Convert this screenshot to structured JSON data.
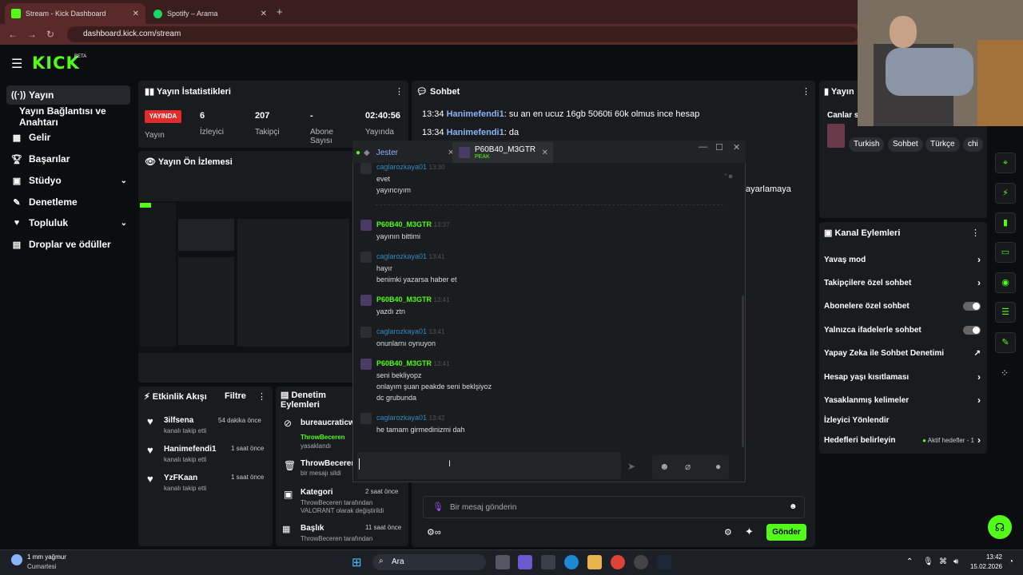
{
  "browser": {
    "tabs": [
      {
        "label": "Stream - Kick Dashboard"
      },
      {
        "label": "Spotify – Arama"
      }
    ],
    "url": "dashboard.kick.com/stream"
  },
  "kick": {
    "logo": "KICK",
    "beta": "BETA"
  },
  "nav": [
    {
      "label": "Yayın",
      "icon": "broadcast-icon"
    },
    {
      "label": "Yayın Bağlantısı ve Anahtarı",
      "icon": ""
    },
    {
      "label": "Gelir",
      "icon": "revenue-icon"
    },
    {
      "label": "Başarılar",
      "icon": "trophy-icon"
    },
    {
      "label": "Stüdyo",
      "icon": "studio-icon"
    },
    {
      "label": "Denetleme",
      "icon": "moderation-icon"
    },
    {
      "label": "Topluluk",
      "icon": "community-icon"
    },
    {
      "label": "Droplar ve ödüller",
      "icon": "drops-icon"
    }
  ],
  "stats": {
    "title": "Yayın İstatistikleri",
    "badge": "YAYINDA",
    "items": [
      {
        "value": "",
        "label": "Yayın"
      },
      {
        "value": "6",
        "label": "İzleyici"
      },
      {
        "value": "207",
        "label": "Takipçi"
      },
      {
        "value": "-",
        "label": "Abone Sayısı"
      },
      {
        "value": "02:40:56",
        "label": "Yayında"
      }
    ]
  },
  "preview": {
    "title": "Yayın Ön İzlemesi"
  },
  "activity": {
    "title": "Etkinlik Akışı",
    "filter": "Filtre",
    "items": [
      {
        "name": "3ilfsena",
        "sub": "kanalı takip etti",
        "time": "54 dakika önce"
      },
      {
        "name": "Hanimefendi1",
        "sub": "kanalı takip etti",
        "time": "1 saat önce"
      },
      {
        "name": "YzFKaan",
        "sub": "kanalı takip etti",
        "time": "1 saat önce"
      }
    ]
  },
  "mod": {
    "title": "Denetim Eylemleri",
    "items": [
      {
        "name": "bureaucraticw",
        "l1": "ThrowBeceren",
        "l2": "yasaklandı",
        "time": ""
      },
      {
        "name": "ThrowBeceren",
        "l1": "bir mesajı sildi",
        "l2": "",
        "time": ""
      },
      {
        "name": "Kategori",
        "l1": "ThrowBeceren tarafından",
        "l2": "VALORANT olarak değiştirildi",
        "time": "2 saat önce"
      },
      {
        "name": "Başlık",
        "l1": "ThrowBeceren tarafından",
        "l2": "",
        "time": "11 saat önce"
      }
    ]
  },
  "chat": {
    "title": "Sohbet",
    "messages": [
      {
        "time": "13:34",
        "user": "Hanimefendi1",
        "text": "su an en ucuz 16gb 5060ti 60k olmus ince hesap"
      },
      {
        "time": "13:34",
        "user": "Hanimefendi1",
        "text": "da"
      }
    ],
    "partial": "ayarlamaya",
    "placeholder": "Bir mesaj gönderin",
    "send": "Gönder"
  },
  "popup": {
    "tab1": "Jester",
    "tab2": "P60B40_M3GTR",
    "tab2sub": "PEAK",
    "messages": [
      {
        "user": "caglarozkaya01",
        "time": "13:30",
        "lines": [
          "evet",
          "yayıncıyım"
        ],
        "peak": false
      },
      {
        "user": "P60B40_M3GTR",
        "time": "13:37",
        "lines": [
          "yayının bittimi"
        ],
        "peak": true
      },
      {
        "user": "caglarozkaya01",
        "time": "13:41",
        "lines": [
          "hayır",
          "benimki yazarsa haber et"
        ],
        "peak": false
      },
      {
        "user": "P60B40_M3GTR",
        "time": "13:41",
        "lines": [
          "yazdı ztn"
        ],
        "peak": true
      },
      {
        "user": "caglarozkaya01",
        "time": "13:41",
        "lines": [
          "onunlarnı oynuyon"
        ],
        "peak": false
      },
      {
        "user": "P60B40_M3GTR",
        "time": "13:41",
        "lines": [
          "seni bekliyopz",
          "onlayım şuan peakde seni beklşiyoz",
          "dc grubunda"
        ],
        "peak": true
      },
      {
        "user": "caglarozkaya01",
        "time": "13:42",
        "lines": [
          "he tamam girmedinizmi dah"
        ],
        "peak": false
      }
    ]
  },
  "right": {
    "title": "Yayın",
    "live_label": "Canlar s",
    "tags": [
      "Turkish",
      "Sohbet",
      "Türkçe",
      "chi"
    ],
    "actions_title": "Kanal Eylemleri",
    "actions": [
      {
        "label": "Yavaş mod",
        "kind": "chevron"
      },
      {
        "label": "Takipçilere özel sohbet",
        "kind": "chevron"
      },
      {
        "label": "Abonelere özel sohbet",
        "kind": "toggle"
      },
      {
        "label": "Yalnızca ifadelerle sohbet",
        "kind": "toggle"
      },
      {
        "label": "Yapay Zeka ile Sohbet Denetimi",
        "kind": "external"
      },
      {
        "label": "Hesap yaşı kısıtlaması",
        "kind": "chevron"
      },
      {
        "label": "Yasaklanmış kelimeler",
        "kind": "chevron"
      },
      {
        "label": "İzleyici Yönlendir",
        "kind": "none"
      },
      {
        "label": "Hedefleri belirleyin",
        "kind": "chevron"
      }
    ],
    "goals_active": "Aktif hedefler - 1"
  },
  "taskbar": {
    "weather": "1 mm yağmur",
    "day": "Cumartesi",
    "search": "Ara",
    "time": "13:42",
    "date": "15.02.2026"
  },
  "colors": {
    "accent": "#53fc18",
    "live": "#e02c2c",
    "panel": "#191b1f"
  }
}
